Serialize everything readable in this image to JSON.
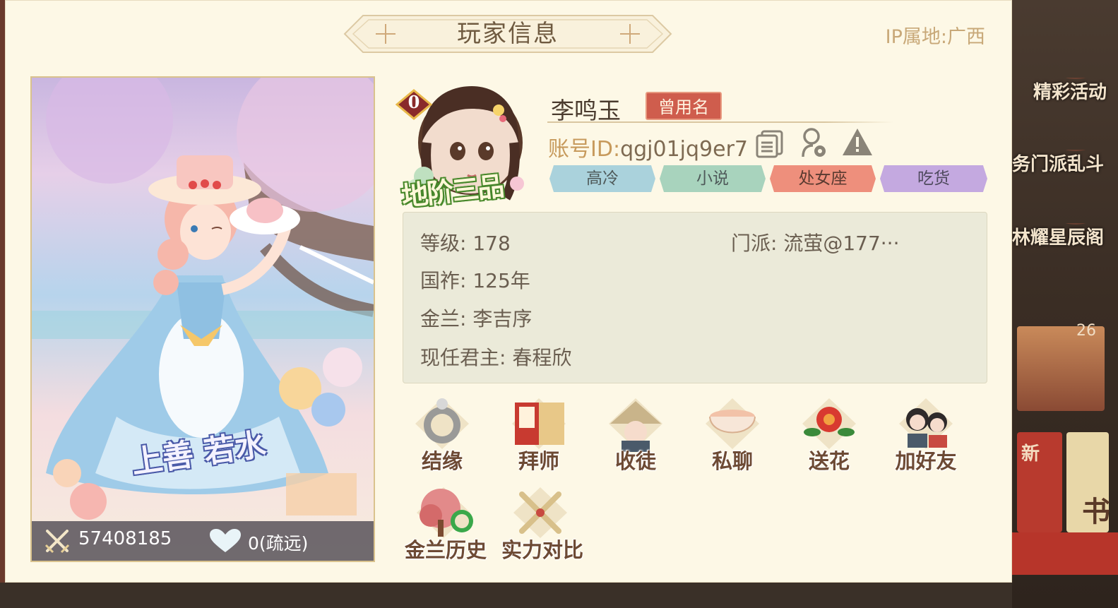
{
  "window": {
    "title": "玩家信息",
    "ip_location": "IP属地:广西"
  },
  "portrait": {
    "outfit_caption": "上善 若水",
    "power_value": "57408185",
    "affinity_value": "0(疏远)"
  },
  "player": {
    "vip_level": "0",
    "rank_title": "地阶三品",
    "name": "李鸣玉",
    "former_name_button": "曾用名",
    "account_id_label": "账号ID:",
    "account_id_value": "qgj01jq9er7",
    "tags": [
      {
        "label": "高冷",
        "color": "#a9d4dc"
      },
      {
        "label": "小说",
        "color": "#a8d2bc"
      },
      {
        "label": "处女座",
        "color": "#ee8f7c"
      },
      {
        "label": "吃货",
        "color": "#c4a9e0"
      }
    ]
  },
  "info": {
    "level": "等级:  178",
    "sect": "门派:  流萤@177···",
    "reign": "国祚:  125年",
    "sworn": "金兰:  李吉序",
    "ruler": "现任君主:  春程欣"
  },
  "actions": [
    {
      "label": "结缘",
      "icon": "ring-icon"
    },
    {
      "label": "拜师",
      "icon": "book-icon"
    },
    {
      "label": "收徒",
      "icon": "student-icon"
    },
    {
      "label": "私聊",
      "icon": "tea-cup-icon"
    },
    {
      "label": "送花",
      "icon": "flower-icon"
    },
    {
      "label": "加好友",
      "icon": "friends-icon"
    },
    {
      "label": "金兰历史",
      "icon": "tree-history-icon"
    },
    {
      "label": "实力对比",
      "icon": "crossed-swords-icon"
    }
  ],
  "background": {
    "items": [
      "精彩活动",
      "务门派乱斗",
      "林耀星辰阁"
    ],
    "badge": "26",
    "card1": "新",
    "card2": "书"
  },
  "colors": {
    "panel": "#fdf8e6",
    "accent_red": "#cf5d4d",
    "title_brown": "#6f5a40"
  }
}
